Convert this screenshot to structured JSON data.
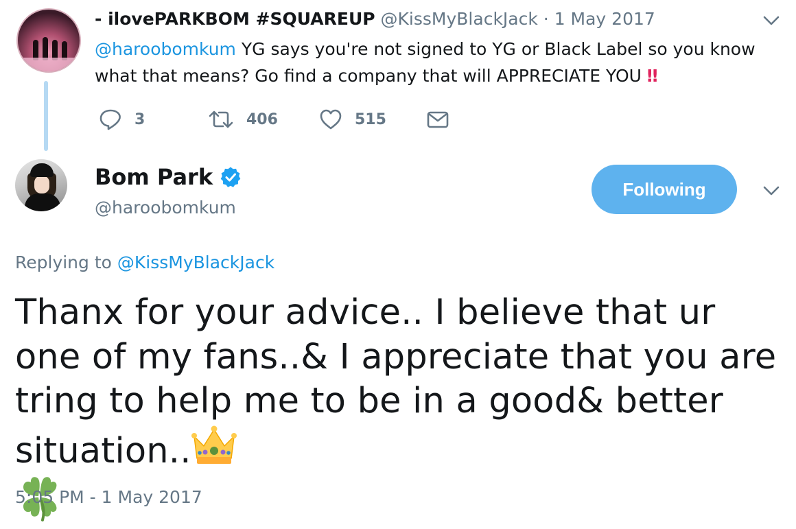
{
  "parent_tweet": {
    "display_name": "- ilovePARKBOM #SQUAREUP",
    "handle": "@KissMyBlackJack",
    "separator": " · ",
    "date": "1 May 2017",
    "mention": "@haroobomkum",
    "text": " YG says you're not signed to YG or Black Label so you know what that means? Go find a company that will APPRECIATE YOU ",
    "emoji_bang": "‼",
    "reply_count": "3",
    "retweet_count": "406",
    "like_count": "515",
    "avatar_icon": "profile-photo-performers-on-stage"
  },
  "main_tweet": {
    "display_name": "Bom Park",
    "verified": true,
    "handle": "@haroobomkum",
    "follow_label": "Following",
    "replying_prefix": "Replying to ",
    "replying_handle": "@KissMyBlackJack",
    "text": "Thanx for your advice.. I believe that ur one of my fans..& I appreciate that you are tring to help me to be in a good& better situation..",
    "emoji_crown": "crown-icon",
    "emoji_clover": "four-leaf-clover-icon",
    "timestamp": "5:05 PM - 1 May 2017",
    "avatar_icon": "profile-photo-woman-black-hat"
  },
  "colors": {
    "link": "#1b95e0",
    "secondary_text": "#657786",
    "follow_button": "#5eb2ee",
    "thread_line": "#b5d9f3",
    "bang": "#e0245e",
    "verified": "#1da1f2"
  }
}
